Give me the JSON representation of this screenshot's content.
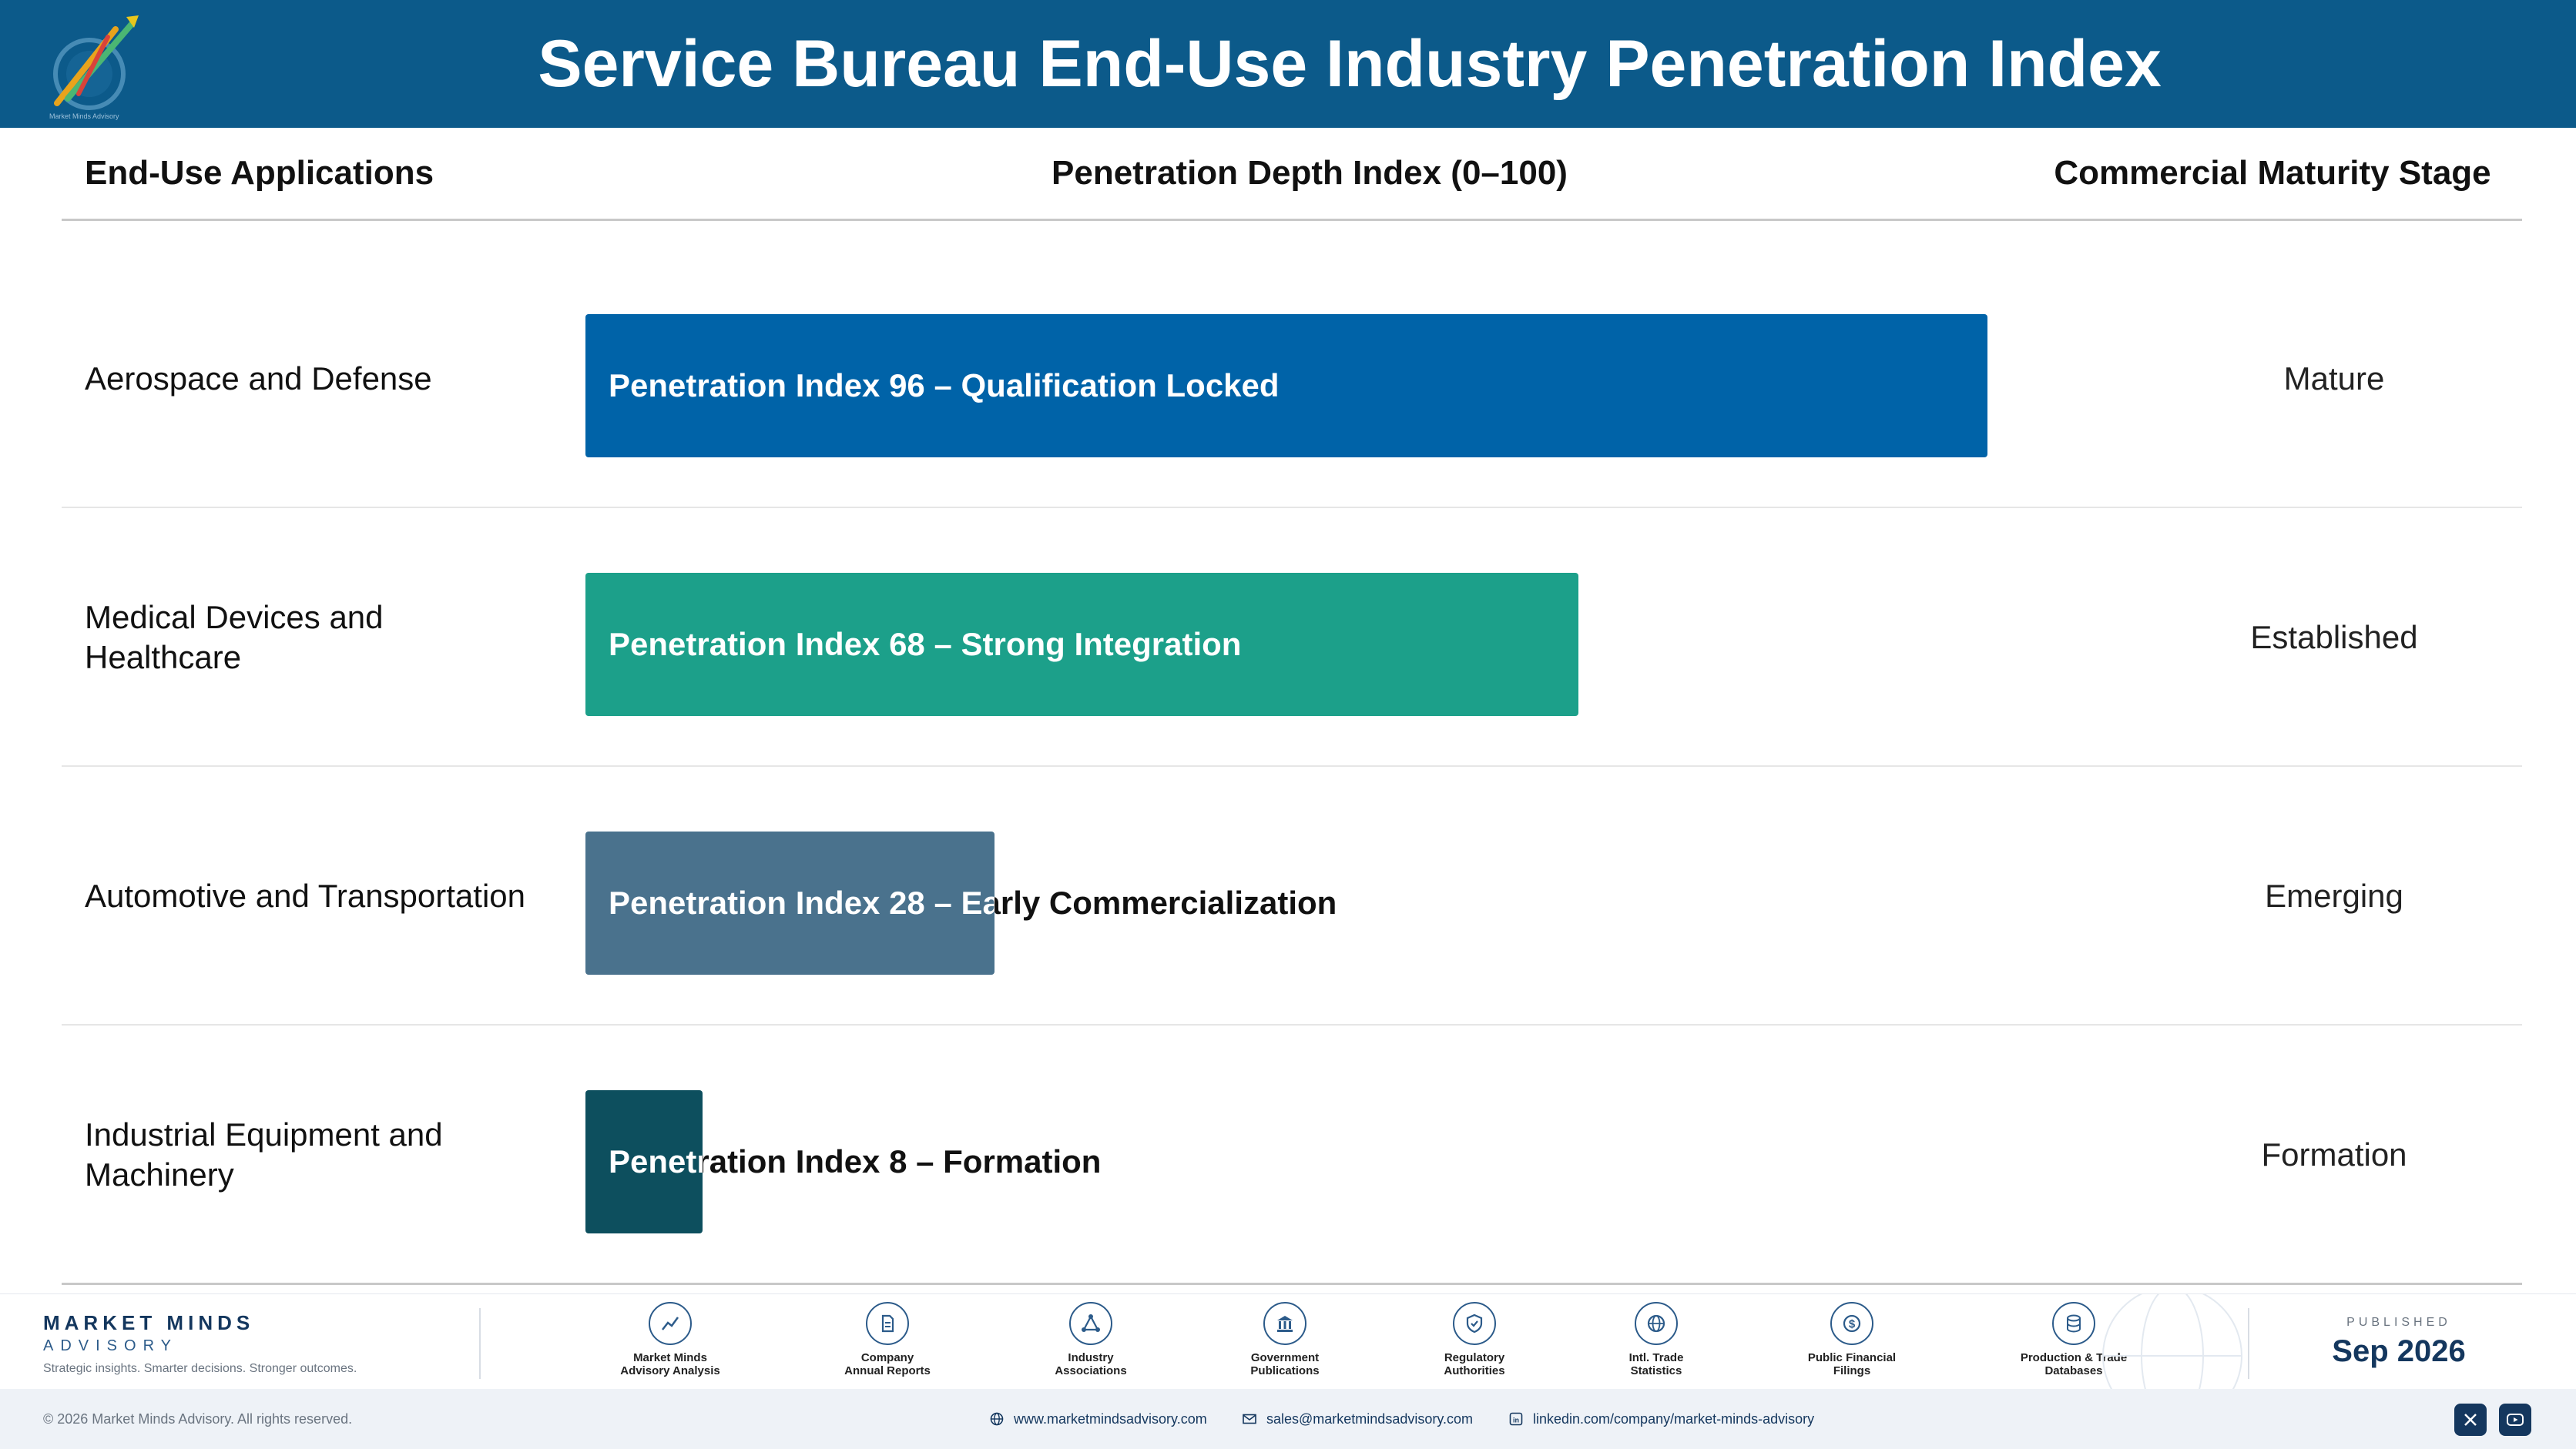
{
  "header": {
    "title": "Service Bureau End-Use Industry Penetration Index"
  },
  "columns": {
    "applications": "End-Use Applications",
    "index": "Penetration Depth Index (0–100)",
    "stage": "Commercial Maturity Stage"
  },
  "chart_data": {
    "type": "bar",
    "orientation": "horizontal",
    "xlim": [
      0,
      100
    ],
    "categories": [
      "Aerospace and Defense",
      "Medical Devices and Healthcare",
      "Automotive and Transportation",
      "Industrial Equipment and Machinery"
    ],
    "values": [
      96,
      68,
      28,
      8
    ],
    "bar_labels": [
      "Penetration Index 96 – Qualification Locked",
      "Penetration Index 68 – Strong Integration",
      "Penetration Index 28 – Early Commercialization",
      "Penetration Index 8 – Formation"
    ],
    "stages": [
      "Mature",
      "Established",
      "Emerging",
      "Formation"
    ],
    "colors": [
      "#0063a8",
      "#1ca08a",
      "#4a728d",
      "#0d4f5e"
    ]
  },
  "footer": {
    "brand_name": "MARKET MINDS",
    "brand_sub": "ADVISORY",
    "tagline": "Strategic insights. Smarter decisions. Stronger outcomes.",
    "sources": [
      {
        "icon": "chart-line-icon",
        "line1": "Market Minds",
        "line2": "Advisory Analysis"
      },
      {
        "icon": "document-icon",
        "line1": "Company",
        "line2": "Annual Reports"
      },
      {
        "icon": "network-icon",
        "line1": "Industry",
        "line2": "Associations"
      },
      {
        "icon": "government-building-icon",
        "line1": "Government",
        "line2": "Publications"
      },
      {
        "icon": "shield-check-icon",
        "line1": "Regulatory",
        "line2": "Authorities"
      },
      {
        "icon": "globe-icon",
        "line1": "Intl. Trade",
        "line2": "Statistics"
      },
      {
        "icon": "dollar-coin-icon",
        "line1": "Public Financial",
        "line2": "Filings"
      },
      {
        "icon": "database-icon",
        "line1": "Production & Trade",
        "line2": "Databases"
      }
    ],
    "published_label": "PUBLISHED",
    "published_date": "Sep 2026",
    "copyright": "© 2026 Market Minds Advisory. All rights reserved.",
    "website": "www.marketmindsadvisory.com",
    "email": "sales@marketmindsadvisory.com",
    "linkedin": "linkedin.com/company/market-minds-advisory"
  }
}
